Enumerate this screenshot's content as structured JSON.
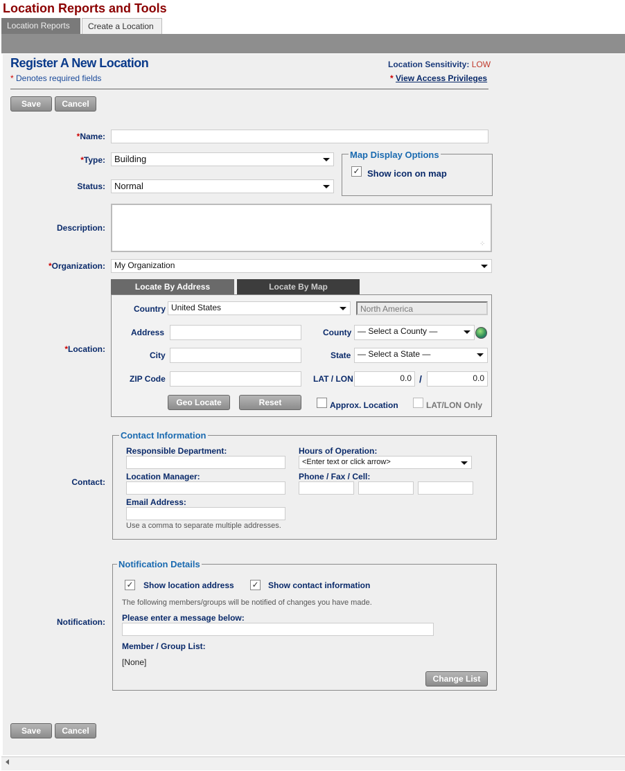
{
  "app": {
    "title": "Location Reports and Tools"
  },
  "tabs": [
    {
      "label": "Location Reports"
    },
    {
      "label": "Create a Location"
    }
  ],
  "page": {
    "heading": "Register A New Location",
    "required_note": "Denotes required fields",
    "sensitivity_label": "Location Sensitivity:",
    "sensitivity_value": "LOW",
    "access_link": "View Access Privileges"
  },
  "buttons": {
    "save": "Save",
    "cancel": "Cancel",
    "geo_locate": "Geo Locate",
    "reset": "Reset",
    "change_list": "Change List"
  },
  "form": {
    "name_label": "Name:",
    "name_value": "",
    "type_label": "Type:",
    "type_value": "Building",
    "status_label": "Status:",
    "status_value": "Normal",
    "description_label": "Description:",
    "description_value": "",
    "organization_label": "Organization:",
    "organization_value": "My Organization",
    "map_display": {
      "legend": "Map Display Options",
      "show_icon_label": "Show icon on map",
      "show_icon_checked": true
    }
  },
  "location": {
    "label": "Location:",
    "tab_address": "Locate By Address",
    "tab_map": "Locate By Map",
    "country_label": "Country",
    "country_value": "United States",
    "region_value": "North America",
    "address_label": "Address",
    "county_label": "County",
    "county_value": "— Select a County —",
    "city_label": "City",
    "state_label": "State",
    "state_value": "— Select a State —",
    "zip_label": "ZIP Code",
    "latlon_label": "LAT / LON",
    "lat_value": "0.0",
    "lon_value": "0.0",
    "latlon_sep": "/",
    "approx_label": "Approx. Location",
    "latlon_only_label": "LAT/LON Only"
  },
  "contact": {
    "label": "Contact:",
    "legend": "Contact Information",
    "dept_label": "Responsible Department:",
    "hours_label": "Hours of Operation:",
    "hours_value": "<Enter text or click arrow>",
    "manager_label": "Location Manager:",
    "phone_label": "Phone / Fax / Cell:",
    "email_label": "Email Address:",
    "email_hint": "Use a comma to separate multiple addresses."
  },
  "notification": {
    "label": "Notification:",
    "legend": "Notification Details",
    "show_address_label": "Show location address",
    "show_address_checked": true,
    "show_contact_label": "Show contact information",
    "show_contact_checked": true,
    "info_text": "The following members/groups will be notified of changes you have made.",
    "message_label": "Please enter a message below:",
    "member_list_label": "Member / Group List:",
    "member_list_value": "[None]"
  },
  "icons": {
    "check": "✓",
    "globe": "globe-icon"
  },
  "colors": {
    "title_red": "#8b0000",
    "heading_blue": "#0a3a8a",
    "legend_blue": "#1a6ab0",
    "required_red": "#cc0000"
  }
}
